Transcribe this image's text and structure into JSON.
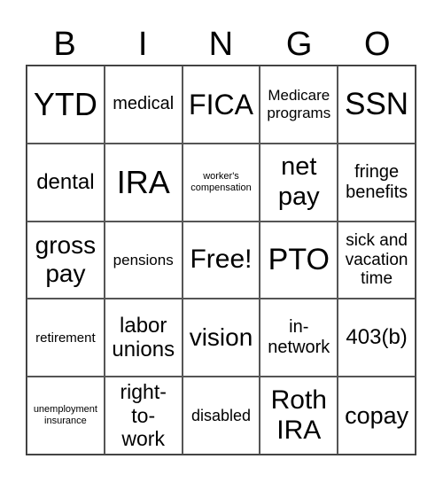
{
  "header": [
    "B",
    "I",
    "N",
    "G",
    "O"
  ],
  "cells": [
    {
      "text": "YTD",
      "size": 36
    },
    {
      "text": "medical",
      "size": 20
    },
    {
      "text": "FICA",
      "size": 32
    },
    {
      "text": "Medicare programs",
      "size": 17
    },
    {
      "text": "SSN",
      "size": 35
    },
    {
      "text": "dental",
      "size": 24
    },
    {
      "text": "IRA",
      "size": 36
    },
    {
      "text": "worker's compensation",
      "size": 11
    },
    {
      "text": "net pay",
      "size": 29
    },
    {
      "text": "fringe benefits",
      "size": 20
    },
    {
      "text": "gross pay",
      "size": 28
    },
    {
      "text": "pensions",
      "size": 17
    },
    {
      "text": "Free!",
      "size": 30
    },
    {
      "text": "PTO",
      "size": 34
    },
    {
      "text": "sick and vacation time",
      "size": 19
    },
    {
      "text": "retirement",
      "size": 15
    },
    {
      "text": "labor unions",
      "size": 24
    },
    {
      "text": "vision",
      "size": 28
    },
    {
      "text": "in-network",
      "size": 20
    },
    {
      "text": "403(b)",
      "size": 24
    },
    {
      "text": "unemployment insurance",
      "size": 11
    },
    {
      "text": "right-to-work",
      "size": 23
    },
    {
      "text": "disabled",
      "size": 18
    },
    {
      "text": "Roth IRA",
      "size": 30
    },
    {
      "text": "copay",
      "size": 27
    }
  ]
}
